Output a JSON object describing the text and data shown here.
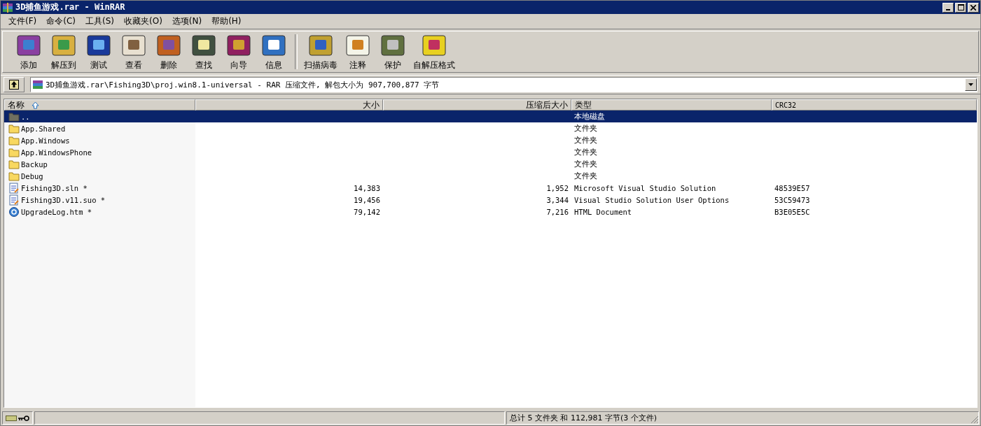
{
  "window": {
    "title": "3D捕鱼游戏.rar - WinRAR"
  },
  "menu": [
    "文件(F)",
    "命令(C)",
    "工具(S)",
    "收藏夹(O)",
    "选项(N)",
    "帮助(H)"
  ],
  "toolbar": {
    "groups": [
      [
        "添加",
        "解压到",
        "测试",
        "查看",
        "删除",
        "查找",
        "向导",
        "信息"
      ],
      [
        "扫描病毒",
        "注释",
        "保护",
        "自解压格式"
      ]
    ]
  },
  "address": {
    "value": "3D捕鱼游戏.rar\\Fishing3D\\proj.win8.1-universal - RAR 压缩文件, 解包大小为 907,700,877 字节"
  },
  "table": {
    "columns": [
      {
        "label": "名称",
        "sorted": true
      },
      {
        "label": "大小",
        "sorted": false
      },
      {
        "label": "压缩后大小",
        "sorted": false
      },
      {
        "label": "类型",
        "sorted": false
      },
      {
        "label": "CRC32",
        "sorted": false
      }
    ],
    "rows": [
      {
        "kind": "up",
        "name": "..",
        "size": "",
        "packed": "",
        "type": "本地磁盘",
        "crc": "",
        "selected": true
      },
      {
        "kind": "folder",
        "name": "App.Shared",
        "size": "",
        "packed": "",
        "type": "文件夹",
        "crc": "",
        "selected": false
      },
      {
        "kind": "folder",
        "name": "App.Windows",
        "size": "",
        "packed": "",
        "type": "文件夹",
        "crc": "",
        "selected": false
      },
      {
        "kind": "folder",
        "name": "App.WindowsPhone",
        "size": "",
        "packed": "",
        "type": "文件夹",
        "crc": "",
        "selected": false
      },
      {
        "kind": "folder",
        "name": "Backup",
        "size": "",
        "packed": "",
        "type": "文件夹",
        "crc": "",
        "selected": false
      },
      {
        "kind": "folder",
        "name": "Debug",
        "size": "",
        "packed": "",
        "type": "文件夹",
        "crc": "",
        "selected": false
      },
      {
        "kind": "document",
        "name": "Fishing3D.sln *",
        "size": "14,383",
        "packed": "1,952",
        "type": "Microsoft Visual Studio Solution",
        "crc": "48539E57",
        "selected": false
      },
      {
        "kind": "document",
        "name": "Fishing3D.v11.suo *",
        "size": "19,456",
        "packed": "3,344",
        "type": "Visual Studio Solution User Options",
        "crc": "53C59473",
        "selected": false
      },
      {
        "kind": "web",
        "name": "UpgradeLog.htm *",
        "size": "79,142",
        "packed": "7,216",
        "type": "HTML Document",
        "crc": "B3E05E5C",
        "selected": false
      }
    ]
  },
  "status_bar": {
    "text": "总计 5 文件夹 和 112,981 字节(3 个文件)"
  }
}
